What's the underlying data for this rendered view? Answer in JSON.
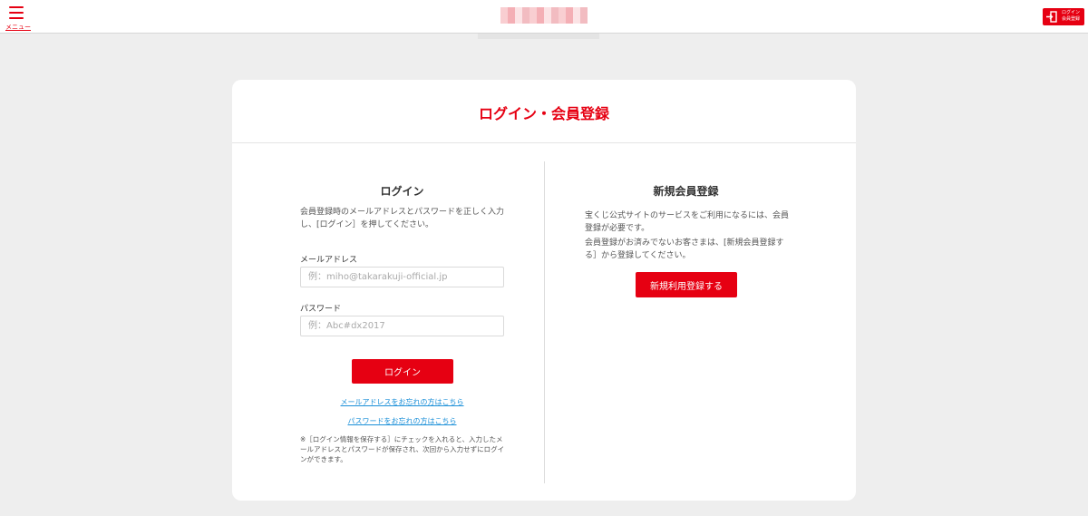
{
  "header": {
    "menu_label": "メニュー",
    "login_badge_line1": "ログイン",
    "login_badge_line2": "会員登録"
  },
  "page": {
    "title": "ログイン・会員登録"
  },
  "login": {
    "title": "ログイン",
    "description": "会員登録時のメールアドレスとパスワードを正しく入力し、[ログイン］を押してください。",
    "email_label": "メールアドレス",
    "email_placeholder": "例：miho@takarakuji-official.jp",
    "password_label": "パスワード",
    "password_placeholder": "例：Abc#dx2017",
    "button_label": "ログイン",
    "forgot_email_link": "メールアドレスをお忘れの方はこちら",
    "forgot_password_link": "パスワードをお忘れの方はこちら",
    "note": "※［ログイン情報を保存する］にチェックを入れると、入力したメールアドレスとパスワードが保存され、次回から入力せずにログインができます。"
  },
  "register": {
    "title": "新規会員登録",
    "description1": "宝くじ公式サイトのサービスをご利用になるには、会員登録が必要です。",
    "description2": "会員登録がお済みでないお客さまは、[新規会員登録する］から登録してください。",
    "button_label": "新規利用登録する"
  },
  "colors": {
    "brand": "#e60012",
    "link": "#1a8fd8",
    "background": "#eeeeee"
  }
}
